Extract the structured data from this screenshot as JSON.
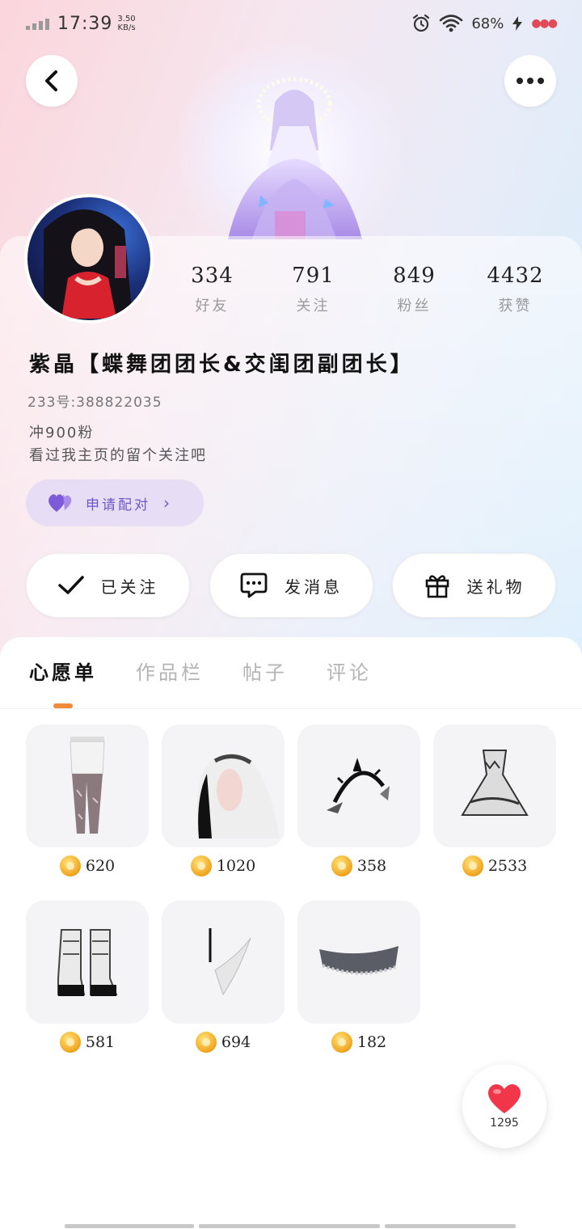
{
  "status_bar": {
    "time": "17:39",
    "speed": "3.50",
    "speed_unit": "KB/s",
    "battery": "68%"
  },
  "profile": {
    "stats": [
      {
        "value": "334",
        "label": "好友"
      },
      {
        "value": "791",
        "label": "关注"
      },
      {
        "value": "849",
        "label": "粉丝"
      },
      {
        "value": "4432",
        "label": "获赞"
      }
    ],
    "name": "紫晶【蝶舞团团长&交闺团副团长】",
    "uid": "233号:388822035",
    "bio_line1": "冲900粉",
    "bio_line2": "看过我主页的留个关注吧",
    "pair_label": "申请配对"
  },
  "actions": {
    "follow": "已关注",
    "message": "发消息",
    "gift": "送礼物"
  },
  "tabs": [
    "心愿单",
    "作品栏",
    "帖子",
    "评论"
  ],
  "wishlist": [
    {
      "price": "620",
      "icon": "leggings-icon"
    },
    {
      "price": "1020",
      "icon": "hair-icon"
    },
    {
      "price": "358",
      "icon": "headpiece-icon"
    },
    {
      "price": "2533",
      "icon": "dress-icon"
    },
    {
      "price": "581",
      "icon": "boots-icon"
    },
    {
      "price": "694",
      "icon": "wing-accessory-icon"
    },
    {
      "price": "182",
      "icon": "lace-choker-icon"
    }
  ],
  "likes": "1295",
  "colors": {
    "accent_orange": "#f28a3c",
    "pair_purple": "#6d58c6",
    "like_red": "#f2364a"
  }
}
